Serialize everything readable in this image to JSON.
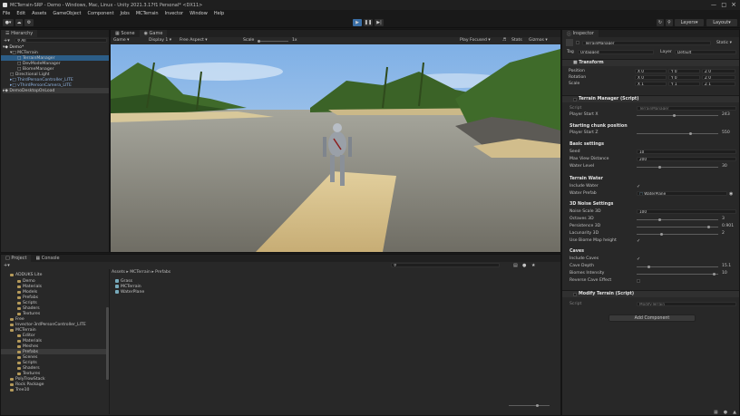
{
  "window": {
    "title": "MCTerrain-SRP - Demo - Windows, Mac, Linux - Unity 2021.3.17f1 Personal* <DX11>"
  },
  "menu": [
    "File",
    "Edit",
    "Assets",
    "GameObject",
    "Component",
    "Jobs",
    "MCTerrain",
    "Invector",
    "Window",
    "Help"
  ],
  "toolbar": {
    "layers": "Layers",
    "layout": "Layout"
  },
  "hierarchy": {
    "tab": "Hierarchy",
    "search_placeholder": "All",
    "items": [
      "Demo*",
      "MCTerrain",
      "TerrainManager",
      "DevModeManager",
      "BiomeManager",
      "Directional Light",
      "ThirdPersonController_LITE",
      "vThirdPersonCamera_LITE",
      "DemoDesktopOnLoad"
    ]
  },
  "scene_tabs": {
    "scene": "Scene",
    "game": "Game"
  },
  "game_toolbar": {
    "display_mode": "Game",
    "display": "Display 1",
    "aspect": "Free Aspect",
    "scale_label": "Scale",
    "scale_value": "1x",
    "play_focused": "Play Focused",
    "stats": "Stats",
    "gizmos": "Gizmos"
  },
  "inspector": {
    "tab": "Inspector",
    "object_name": "TerrainManager",
    "static_label": "Static",
    "tag_label": "Tag",
    "tag_value": "Untagged",
    "layer_label": "Layer",
    "layer_value": "Default",
    "transform": {
      "title": "Transform",
      "rows": [
        {
          "label": "Position",
          "x": "0",
          "y": "0",
          "z": "0"
        },
        {
          "label": "Rotation",
          "x": "0",
          "y": "0",
          "z": "0"
        },
        {
          "label": "Scale",
          "x": "1",
          "y": "1",
          "z": "1"
        }
      ]
    },
    "terrain_manager": {
      "title": "Terrain Manager (Script)",
      "script_label": "Script",
      "script_value": "TerrainManager",
      "player_start_x_label": "Player Start X",
      "player_start_x": "243",
      "section_start": "Starting chunk position",
      "player_start_z_label": "Player Start Z",
      "player_start_z": "550",
      "section_basic": "Basic settings",
      "seed_label": "Seed",
      "seed": "10",
      "max_view_label": "Max View Distance",
      "max_view": "200",
      "water_level_label": "Water Level",
      "water_level": "30",
      "section_water": "Terrain Water",
      "include_water_label": "Include Water",
      "water_prefab_label": "Water Prefab",
      "water_prefab": "WaterPlane",
      "section_noise": "3D Noise Settings",
      "noise_scale_label": "Noise Scale 3D",
      "noise_scale": "100",
      "octaves_label": "Octaves 3D",
      "octaves": "3",
      "persistence_label": "Persistence 3D",
      "persistence": "0.901",
      "lacunarity_label": "Lacunarity 3D",
      "lacunarity": "2",
      "biome_height_label": "Use Biome Map height",
      "section_caves": "Caves",
      "include_caves_label": "Include Caves",
      "cave_depth_label": "Cave Depth",
      "cave_depth": "15.1",
      "biome_intensity_label": "Biomes Intensity",
      "biome_intensity": "10",
      "reverse_cave_label": "Reverse Cave Effect"
    },
    "modify_terrain": {
      "title": "Modify Terrain (Script)",
      "script_label": "Script",
      "script_value": "ModifyTerrain"
    },
    "add_component": "Add Component"
  },
  "project": {
    "tab_project": "Project",
    "tab_console": "Console",
    "breadcrumb": [
      "Assets",
      "MCTerrain",
      "Prefabs"
    ],
    "tree": [
      "ADDUKS Lite",
      "Demo",
      "Materials",
      "Models",
      "Prefabs",
      "Scripts",
      "Shaders",
      "Textures",
      "Free",
      "Invector-3rdPersonController_LITE",
      "MCTerrain",
      "Editor",
      "Materials",
      "Meshes",
      "Prefabs",
      "Scenes",
      "Scripts",
      "Shaders",
      "Textures",
      "PolyTrowStack",
      "Rock Package",
      "Tree10"
    ],
    "files": [
      "Grass",
      "MCTerrain",
      "WaterPlane"
    ]
  },
  "colors": {
    "accent": "#2c5d87",
    "panel": "#282828"
  }
}
